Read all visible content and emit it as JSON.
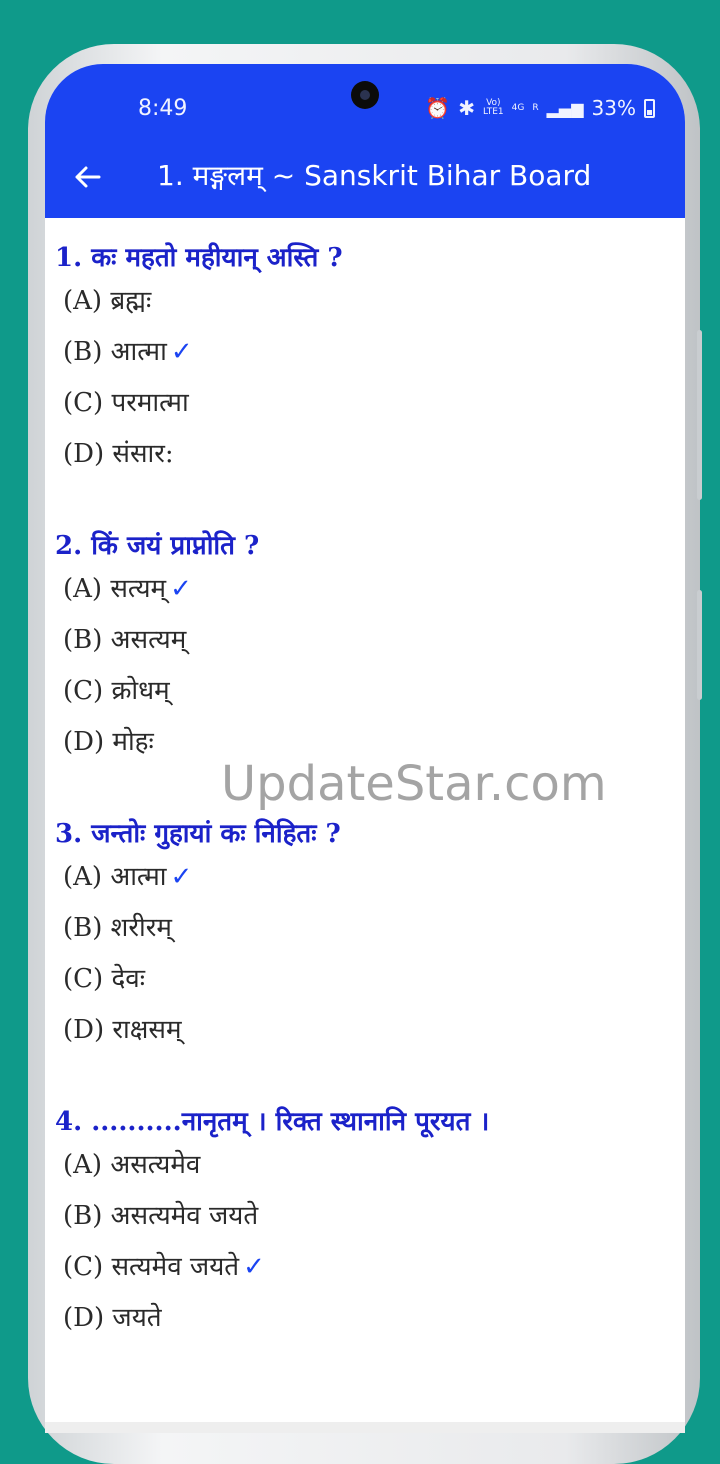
{
  "status_bar": {
    "time": "8:49",
    "network_top": "Vo)",
    "network_bottom": "LTE1",
    "net_4g": "4G",
    "roaming": "R",
    "battery": "33%"
  },
  "app_bar": {
    "title": "1. मङ्गलम् ~ Sanskrit Bihar Board"
  },
  "questions": [
    {
      "question": "1. कः महतो महीयान् अस्ति ?",
      "options": [
        "(A) ब्रह्मः",
        "(B) आत्मा",
        "(C) परमात्मा",
        "(D) संसार:"
      ],
      "correct_index": 1
    },
    {
      "question": "2. किं जयं प्राप्नोति ?",
      "options": [
        "(A) सत्यम्",
        "(B) असत्यम्",
        "(C) क्रोधम्",
        "(D) मोहः"
      ],
      "correct_index": 0
    },
    {
      "question": "3. जन्तोः गुहायां कः निहितः ?",
      "options": [
        "(A) आत्मा",
        "(B) शरीरम्",
        "(C) देवः",
        "(D) राक्षसम्"
      ],
      "correct_index": 0
    },
    {
      "question": "4. ..........नानृतम् । रिक्त स्थानानि पूरयत ।",
      "options": [
        "(A) असत्यमेव",
        "(B) असत्यमेव जयते",
        "(C) सत्यमेव जयते",
        "(D) जयते"
      ],
      "correct_index": 2
    }
  ],
  "correct_mark": "✓",
  "watermark": "UpdateStar.com",
  "colors": {
    "background": "#0f9a8a",
    "app_bar": "#1b44f2",
    "question_text": "#1b22c9",
    "check_mark": "#1b44f2"
  }
}
